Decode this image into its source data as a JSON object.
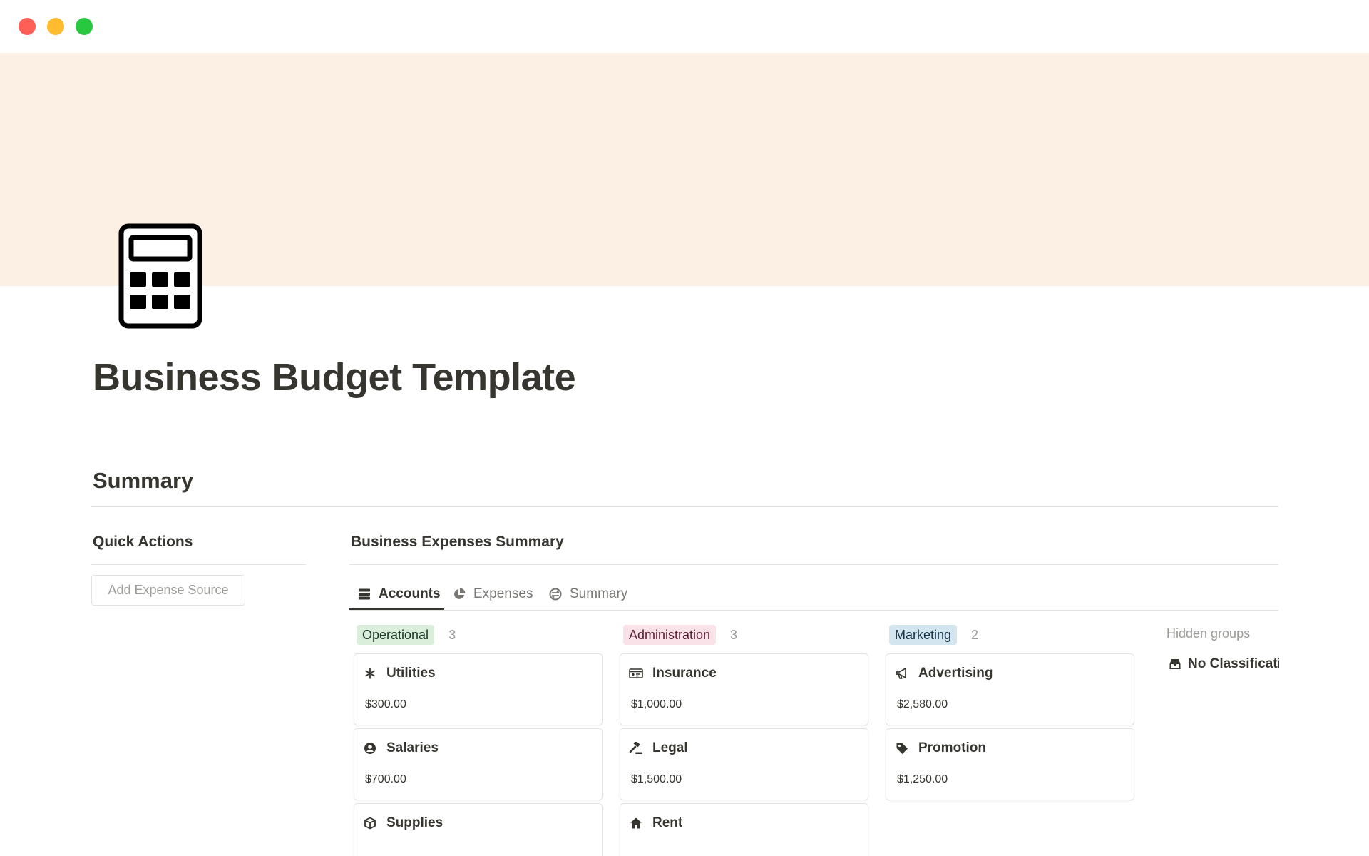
{
  "window": {
    "controls": [
      "close",
      "minimize",
      "zoom"
    ]
  },
  "page": {
    "icon": "calculator-icon",
    "title": "Business Budget Template"
  },
  "summary": {
    "heading": "Summary",
    "quick_actions": {
      "heading": "Quick Actions",
      "add_button_label": "Add Expense Source"
    },
    "expenses": {
      "heading": "Business Expenses Summary",
      "tabs": [
        {
          "label": "Accounts",
          "icon": "table-icon",
          "active": true
        },
        {
          "label": "Expenses",
          "icon": "pie-chart-icon",
          "active": false
        },
        {
          "label": "Summary",
          "icon": "exchange-icon",
          "active": false
        }
      ],
      "groups": [
        {
          "label": "Operational",
          "count": "3",
          "bg": "#dbeddb",
          "fg": "#1c3829",
          "cards": [
            {
              "name": "Utilities",
              "amount": "$300.00",
              "icon": "asterisk-icon"
            },
            {
              "name": "Salaries",
              "amount": "$700.00",
              "icon": "user-circle-icon"
            },
            {
              "name": "Supplies",
              "amount": "",
              "icon": "box-icon"
            }
          ]
        },
        {
          "label": "Administration",
          "count": "3",
          "bg": "#f9e2e8",
          "fg": "#5a1d34",
          "cards": [
            {
              "name": "Insurance",
              "amount": "$1,000.00",
              "icon": "id-card-icon"
            },
            {
              "name": "Legal",
              "amount": "$1,500.00",
              "icon": "gavel-icon"
            },
            {
              "name": "Rent",
              "amount": "",
              "icon": "home-icon"
            }
          ]
        },
        {
          "label": "Marketing",
          "count": "2",
          "bg": "#d3e5ef",
          "fg": "#183347",
          "cards": [
            {
              "name": "Advertising",
              "amount": "$2,580.00",
              "icon": "megaphone-icon"
            },
            {
              "name": "Promotion",
              "amount": "$1,250.00",
              "icon": "tag-icon"
            }
          ]
        }
      ],
      "hidden_groups": {
        "label": "Hidden groups",
        "items": [
          {
            "label": "No Classificati",
            "icon": "inbox-icon"
          }
        ]
      }
    }
  },
  "colors": {
    "cover": "#fcefe3",
    "text": "#37352f",
    "muted": "#9b9a97",
    "border": "#e3e2e0"
  }
}
